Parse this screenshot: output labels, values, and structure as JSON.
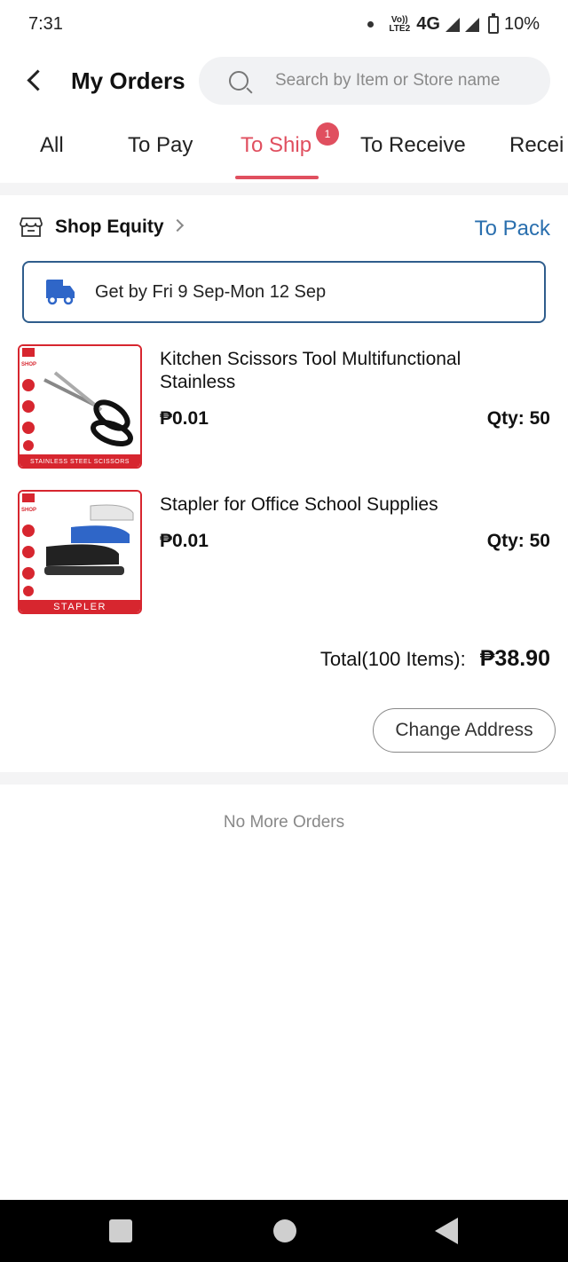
{
  "status_bar": {
    "time": "7:31",
    "network": "4G",
    "volte": "Vo)) LTE2",
    "battery": "10%"
  },
  "header": {
    "title": "My Orders",
    "search_placeholder": "Search by Item or Store name"
  },
  "tabs": [
    {
      "label": "All"
    },
    {
      "label": "To Pay"
    },
    {
      "label": "To Ship",
      "active": true,
      "badge": "1"
    },
    {
      "label": "To Receive"
    },
    {
      "label": "Recei"
    }
  ],
  "order": {
    "shop_name": "Shop Equity",
    "status": "To Pack",
    "delivery_text": "Get by Fri 9 Sep-Mon 12 Sep",
    "items": [
      {
        "title": "Kitchen Scissors Tool Multifunctional Stainless",
        "price": "₱0.01",
        "qty": "Qty: 50",
        "thumb_label": "STAINLESS STEEL SCISSORS",
        "thumb_brand": "SHOP"
      },
      {
        "title": "Stapler for Office School Supplies",
        "price": "₱0.01",
        "qty": "Qty: 50",
        "thumb_label": "STAPLER",
        "thumb_brand": "SHOP"
      }
    ],
    "total_label": "Total(100 Items):",
    "total_value": "₱38.90",
    "change_address_label": "Change Address"
  },
  "footer_text": "No More Orders",
  "colors": {
    "accent": "#e04f5f",
    "status_blue": "#2a6fae",
    "box_border": "#2f5d8c",
    "brand_red": "#d7262f"
  }
}
